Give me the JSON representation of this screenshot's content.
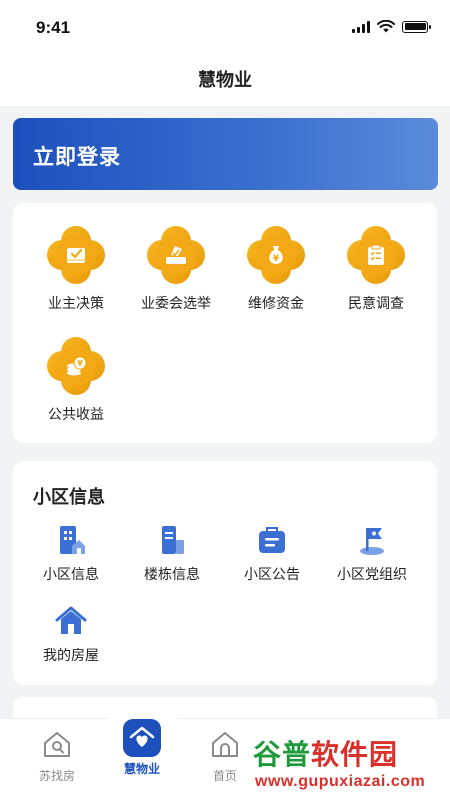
{
  "status_bar": {
    "time": "9:41"
  },
  "nav": {
    "title": "慧物业"
  },
  "login_banner": {
    "text": "立即登录"
  },
  "services": [
    {
      "label": "业主决策",
      "icon": "box-check-icon"
    },
    {
      "label": "业委会选举",
      "icon": "ballot-icon"
    },
    {
      "label": "维修资金",
      "icon": "money-bag-icon"
    },
    {
      "label": "民意调查",
      "icon": "survey-clipboard-icon"
    },
    {
      "label": "公共收益",
      "icon": "coin-stack-icon"
    }
  ],
  "community": {
    "title": "小区信息",
    "items": [
      {
        "label": "小区信息",
        "icon": "building-icon"
      },
      {
        "label": "楼栋信息",
        "icon": "tower-icon"
      },
      {
        "label": "小区公告",
        "icon": "notice-bag-icon"
      },
      {
        "label": "小区党组织",
        "icon": "flag-icon"
      },
      {
        "label": "我的房屋",
        "icon": "house-icon"
      }
    ]
  },
  "tabs": [
    {
      "label": "苏找房",
      "icon": "house-search-icon",
      "active": false
    },
    {
      "label": "慧物业",
      "icon": "heart-home-icon",
      "active": true
    },
    {
      "label": "首页",
      "icon": "home-icon",
      "active": false
    }
  ],
  "watermark": {
    "brand_part1": "谷普",
    "brand_part2": "软件园",
    "url": "www.gupuxiazai.com"
  },
  "colors": {
    "brand_blue": "#1d50bd",
    "accent_orange": "#f3a915",
    "background": "#f2f3f5"
  }
}
